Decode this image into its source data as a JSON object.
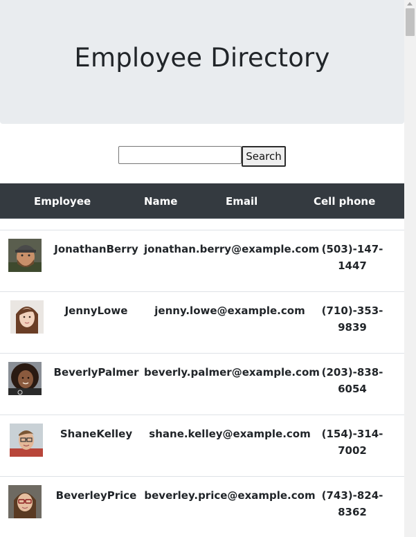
{
  "header": {
    "title": "Employee Directory"
  },
  "search": {
    "value": "",
    "button_label": "Search"
  },
  "table": {
    "columns": [
      "Employee",
      "Name",
      "Email",
      "Cell phone"
    ],
    "rows": [
      {
        "name": "JonathanBerry",
        "email": "jonathan.berry@example.com",
        "phone": "(503)-147-1447",
        "avatar": "avatar-man-beard-cap"
      },
      {
        "name": "JennyLowe",
        "email": "jenny.lowe@example.com",
        "phone": "(710)-353-9839",
        "avatar": "avatar-woman-brown-hair"
      },
      {
        "name": "BeverlyPalmer",
        "email": "beverly.palmer@example.com",
        "phone": "(203)-838-6054",
        "avatar": "avatar-woman-curly-hair"
      },
      {
        "name": "ShaneKelley",
        "email": "shane.kelley@example.com",
        "phone": "(154)-314-7002",
        "avatar": "avatar-man-glasses"
      },
      {
        "name": "BeverleyPrice",
        "email": "beverley.price@example.com",
        "phone": "(743)-824-8362",
        "avatar": "avatar-woman-glasses"
      }
    ]
  },
  "colors": {
    "jumbotron_bg": "#e9ecef",
    "table_head_bg": "#343a40",
    "row_border": "#dee2e6"
  }
}
